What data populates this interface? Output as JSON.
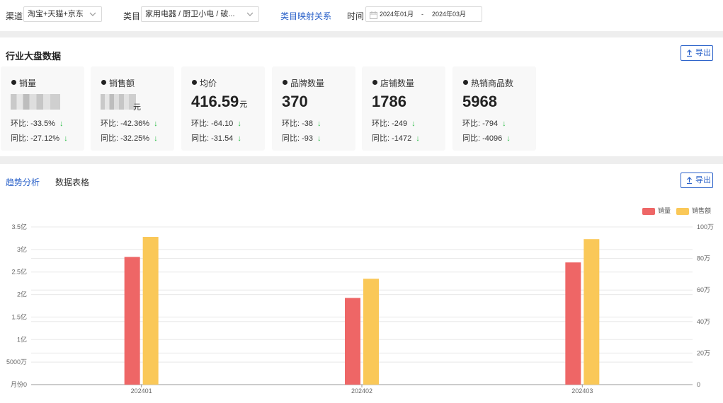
{
  "filters": {
    "channel_label": "渠道",
    "channel_value": "淘宝+天猫+京东",
    "category_label": "类目",
    "category_value": "家用电器 / 厨卫小电 / 破...",
    "mapping_link": "类目映射关系",
    "time_label": "时间",
    "date_start": "2024年01月",
    "date_sep": "-",
    "date_end": "2024年03月"
  },
  "industry": {
    "title": "行业大盘数据",
    "export_label": "导出"
  },
  "cards": [
    {
      "name": "销量",
      "value": "",
      "unit": "",
      "blurred": true,
      "mom": "环比: -33.5%",
      "yoy": "同比: -27.12%"
    },
    {
      "name": "销售额",
      "value": "",
      "unit": "元",
      "blurred": true,
      "mom": "环比: -42.36%",
      "yoy": "同比: -32.25%"
    },
    {
      "name": "均价",
      "value": "416.59",
      "unit": "元",
      "blurred": false,
      "mom": "环比: -64.10",
      "yoy": "同比: -31.54"
    },
    {
      "name": "品牌数量",
      "value": "370",
      "unit": "",
      "blurred": false,
      "mom": "环比: -38",
      "yoy": "同比: -93"
    },
    {
      "name": "店铺数量",
      "value": "1786",
      "unit": "",
      "blurred": false,
      "mom": "环比: -249",
      "yoy": "同比: -1472"
    },
    {
      "name": "热销商品数",
      "value": "5968",
      "unit": "",
      "blurred": false,
      "mom": "环比: -794",
      "yoy": "同比: -4096"
    }
  ],
  "tabs": {
    "trend": "趋势分析",
    "table": "数据表格",
    "export_label": "导出"
  },
  "icons": {
    "chevron": "chevron-down-icon",
    "calendar": "calendar-icon",
    "export": "upload-icon",
    "arrow": "arrow-down-icon"
  },
  "colors": {
    "primary": "#2b62c9",
    "sales_volume": "#ee6666",
    "sales_amount": "#fac858",
    "down_arrow": "#2fbf4a"
  },
  "chart_data": {
    "type": "bar",
    "categories": [
      "202401",
      "202402",
      "202403"
    ],
    "series": [
      {
        "name": "销量",
        "axis": "right",
        "values": [
          810000,
          550000,
          775000
        ]
      },
      {
        "name": "销售额",
        "axis": "left",
        "values": [
          328000000,
          235000000,
          323000000
        ]
      }
    ],
    "left_axis": {
      "ticks": [
        "月份0",
        "5000万",
        "1亿",
        "1.5亿",
        "2亿",
        "2.5亿",
        "3亿",
        "3.5亿"
      ],
      "ylim": [
        0,
        350000000
      ]
    },
    "right_axis": {
      "ticks": [
        "0",
        "20万",
        "40万",
        "60万",
        "80万",
        "100万"
      ],
      "ylim": [
        0,
        1000000
      ]
    },
    "legend": [
      "销量",
      "销售额"
    ],
    "legend_position": "top-right",
    "grid": true
  }
}
